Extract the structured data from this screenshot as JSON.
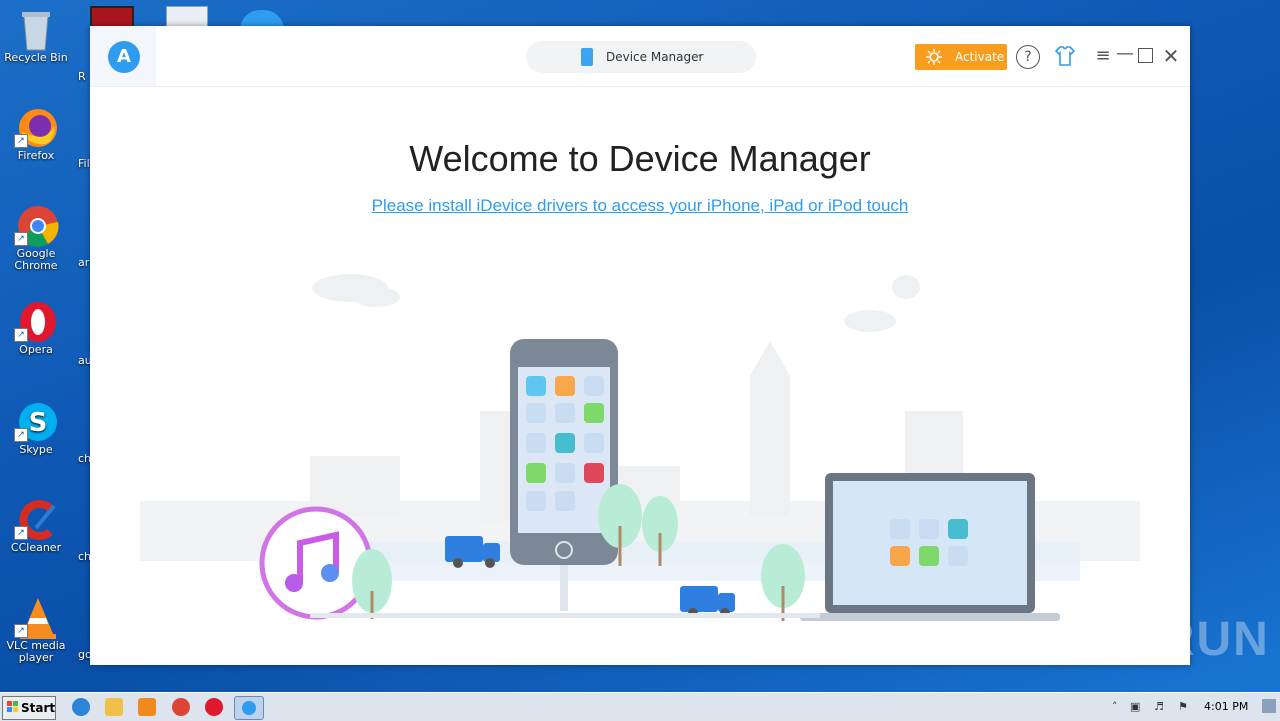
{
  "desktop": {
    "icons": [
      {
        "label": "Recycle Bin",
        "icon": "recycle-bin-icon"
      },
      {
        "label": "Firefox",
        "icon": "firefox-icon"
      },
      {
        "label": "Google Chrome",
        "icon": "chrome-icon"
      },
      {
        "label": "Opera",
        "icon": "opera-icon"
      },
      {
        "label": "Skype",
        "icon": "skype-icon"
      },
      {
        "label": "CCleaner",
        "icon": "ccleaner-icon"
      },
      {
        "label": "VLC media player",
        "icon": "vlc-icon"
      }
    ],
    "second_column_fragments": [
      "R",
      "Fil",
      "ar",
      "au",
      "ch",
      "ch",
      "go"
    ]
  },
  "app": {
    "device_dropdown": "Device Manager",
    "activate_label": "Activate",
    "help_glyph": "?",
    "welcome_title": "Welcome to Device Manager",
    "install_link": "Please install iDevice drivers to access your iPhone, iPad or iPod touch",
    "colors": {
      "accent": "#2e9cf0",
      "activate": "#f89d1d"
    }
  },
  "taskbar": {
    "start_label": "Start",
    "clock": "4:01 PM",
    "pinned": [
      "internet-explorer-icon",
      "explorer-icon",
      "media-player-icon",
      "chrome-icon",
      "opera-icon",
      "app-icon"
    ]
  },
  "watermark": "ANY RUN"
}
